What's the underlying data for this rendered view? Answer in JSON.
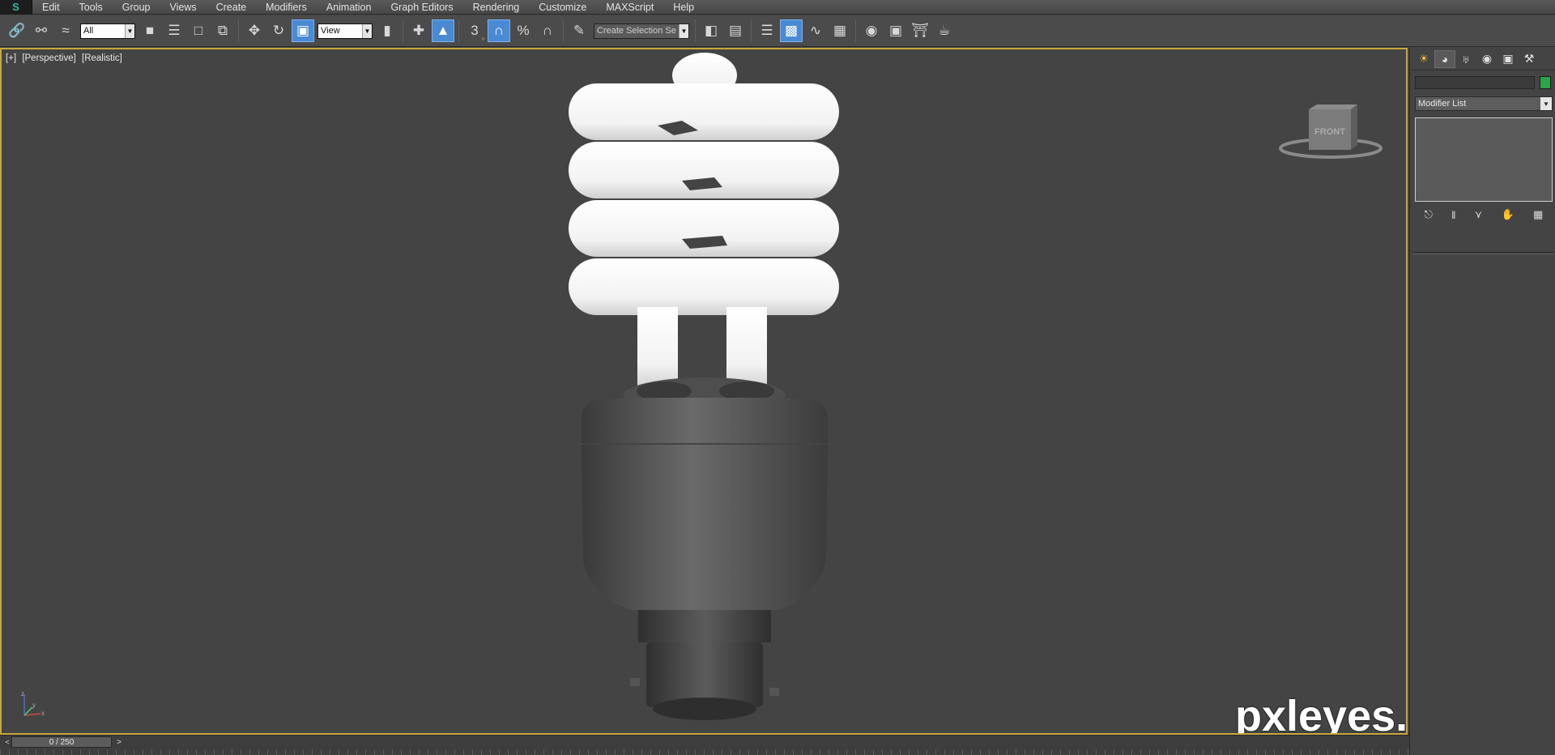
{
  "menu": {
    "app_button": "S",
    "items": [
      "Edit",
      "Tools",
      "Group",
      "Views",
      "Create",
      "Modifiers",
      "Animation",
      "Graph Editors",
      "Rendering",
      "Customize",
      "MAXScript",
      "Help"
    ]
  },
  "toolbar": {
    "selection_filter": "All",
    "ref_coord": "View",
    "snap_angle_label": "3",
    "snap_percent_label": "%",
    "named_selection_placeholder": "Create Selection Se"
  },
  "viewport": {
    "labels": [
      "[+]",
      "[Perspective]",
      "[Realistic]"
    ],
    "viewcube_face": "FRONT",
    "axis_x": "x",
    "axis_y": "y",
    "axis_z": "z"
  },
  "command_panel": {
    "modifier_list": "Modifier List",
    "object_color": "#2aa34a"
  },
  "timeline": {
    "frame_display": "0 / 250",
    "prev_arrow": "<",
    "next_arrow": ">"
  },
  "watermark": "pxleyes.com"
}
